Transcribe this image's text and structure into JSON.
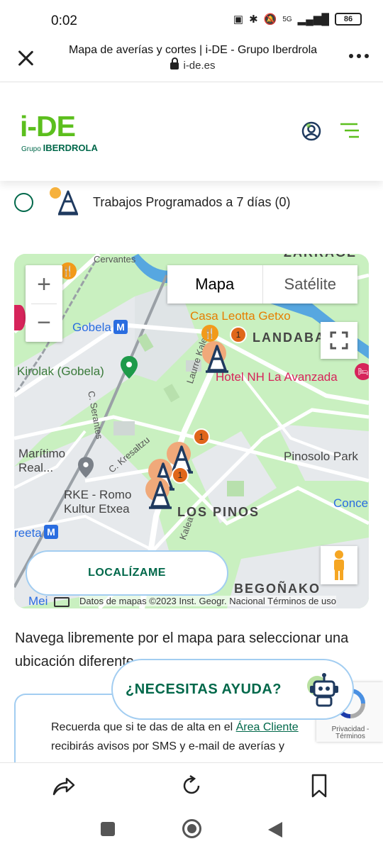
{
  "status": {
    "time": "0:02",
    "network": "5G",
    "battery": "86"
  },
  "browser": {
    "title": "Mapa de averías y cortes | i-DE - Grupo Iberdrola",
    "url": "i-de.es"
  },
  "site": {
    "logo_main": "i-DE",
    "logo_sub_prefix": "Grupo",
    "logo_sub_brand": "IBERDROLA"
  },
  "filter": {
    "label": "Trabajos Programados a 7 días (0)"
  },
  "map": {
    "type_map": "Mapa",
    "type_satellite": "Satélite",
    "labels": {
      "poi_casa": "Casa Leotta Getxo",
      "landaba": "LANDABA",
      "gobela": "Gobela",
      "kirolak": "Kirolak (Gobela)",
      "hotel": "Hotel NH La Avanzada",
      "serantes": "C. Serantes",
      "kalea": "Laurre Kalea",
      "kresaltzu": "C. Kresaltzu",
      "maritimo1": "Marítimo",
      "maritimo2": "Real...",
      "pinosolo": "Pinosolo Park",
      "rke1": "RKE - Romo",
      "rke2": "Kultur Etxea",
      "lospinos": "LOS PINOS",
      "conce": "Conce",
      "reeta": "reeta",
      "begonako": "BEGOÑAKO",
      "zarragate": "ZARRAGE",
      "cervantes": "Cervantes",
      "mei": "Mei",
      "kalea2": "Kalea"
    },
    "markers": [
      {
        "count": "1"
      },
      {
        "count": "1"
      },
      {
        "count": "1"
      }
    ],
    "locate_label": "LOCALÍZAME",
    "attribution": "Datos de mapas ©2023 Inst. Geogr. Nacional   Términos de uso"
  },
  "content": {
    "nav_text": "Navega libremente por el mapa para seleccionar una ubicación diferente.",
    "notice_prefix": "Recuerda que si te das de alta en el ",
    "notice_link": "Área Cliente",
    "notice_suffix": " recibirás avisos por SMS y e-mail de averías y",
    "help_label": "¿NECESITAS AYUDA?",
    "recaptcha": "Privacidad - Términos"
  },
  "colors": {
    "brand_green": "#5cbf1e",
    "brand_dark": "#00684a",
    "accent_blue": "#a2cdf1",
    "marker_orange": "#e0661a"
  }
}
